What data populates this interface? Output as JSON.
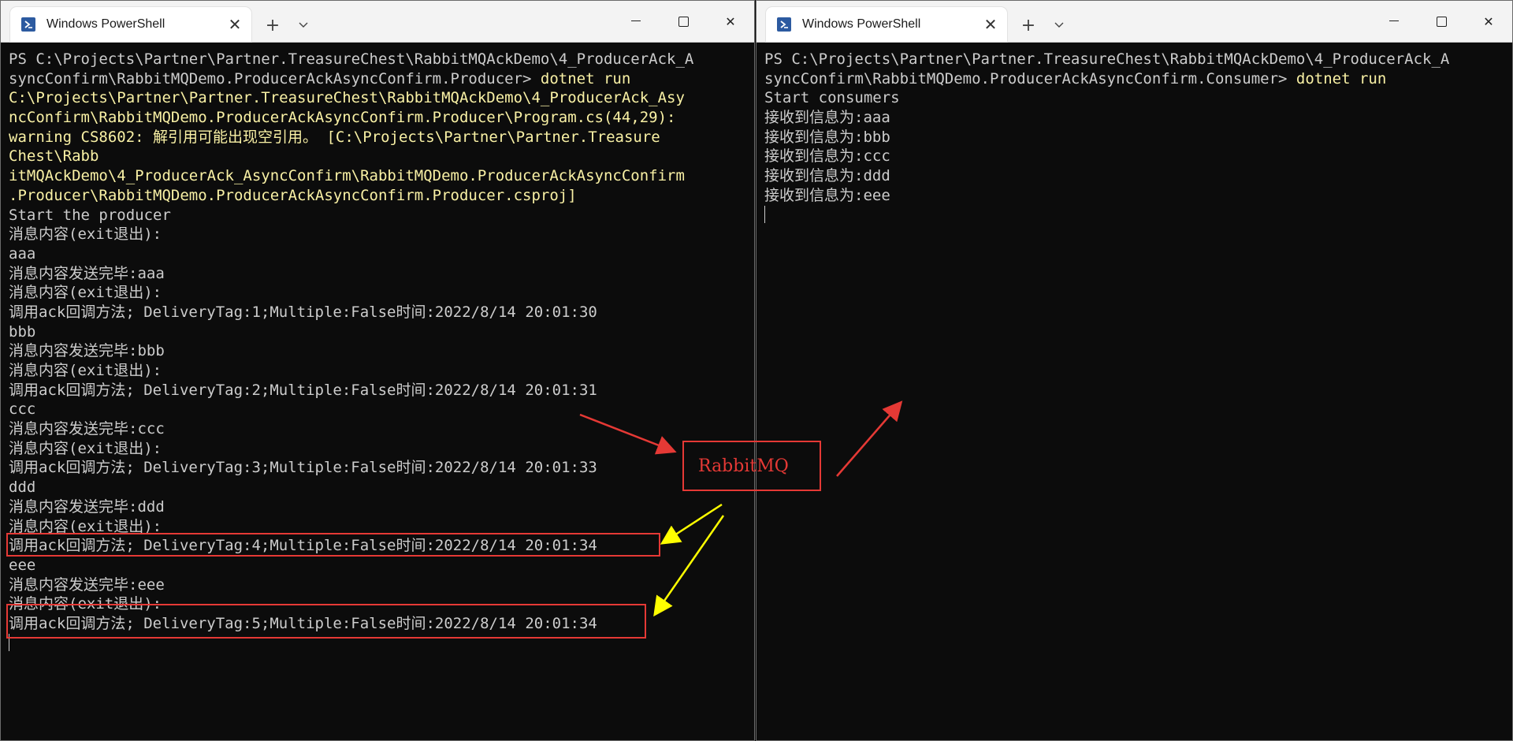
{
  "left_window": {
    "tab_title": "Windows PowerShell",
    "new_tab_label": "+",
    "dropdown_label": "⌄",
    "lines": [
      {
        "parts": [
          {
            "t": "PS C:\\Projects\\Partner\\Partner.TreasureChest\\RabbitMQAckDemo\\4_ProducerAck_A",
            "c": ""
          }
        ]
      },
      {
        "parts": [
          {
            "t": "syncConfirm\\RabbitMQDemo.ProducerAckAsyncConfirm.Producer> ",
            "c": ""
          },
          {
            "t": "dotnet run",
            "c": "cmd"
          }
        ]
      },
      {
        "warn": true,
        "parts": [
          {
            "t": "C:\\Projects\\Partner\\Partner.TreasureChest\\RabbitMQAckDemo\\4_ProducerAck_Asy",
            "c": ""
          }
        ]
      },
      {
        "warn": true,
        "parts": [
          {
            "t": "ncConfirm\\RabbitMQDemo.ProducerAckAsyncConfirm.Producer\\Program.cs(44,29):",
            "c": ""
          }
        ]
      },
      {
        "warn": true,
        "parts": [
          {
            "t": "warning CS8602: 解引用可能出现空引用。 [C:\\Projects\\Partner\\Partner.Treasure",
            "c": ""
          }
        ]
      },
      {
        "warn": true,
        "parts": [
          {
            "t": "Chest\\Rabb",
            "c": ""
          }
        ]
      },
      {
        "warn": true,
        "parts": [
          {
            "t": "itMQAckDemo\\4_ProducerAck_AsyncConfirm\\RabbitMQDemo.ProducerAckAsyncConfirm",
            "c": ""
          }
        ]
      },
      {
        "warn": true,
        "parts": [
          {
            "t": ".Producer\\RabbitMQDemo.ProducerAckAsyncConfirm.Producer.csproj]",
            "c": ""
          }
        ]
      },
      {
        "parts": [
          {
            "t": "Start the producer",
            "c": ""
          }
        ]
      },
      {
        "parts": [
          {
            "t": "消息内容(exit退出):",
            "c": ""
          }
        ]
      },
      {
        "parts": [
          {
            "t": "aaa",
            "c": ""
          }
        ]
      },
      {
        "parts": [
          {
            "t": "消息内容发送完毕:aaa",
            "c": ""
          }
        ]
      },
      {
        "parts": [
          {
            "t": "消息内容(exit退出):",
            "c": ""
          }
        ]
      },
      {
        "parts": [
          {
            "t": "调用ack回调方法; DeliveryTag:1;Multiple:False时间:2022/8/14 20:01:30",
            "c": ""
          }
        ]
      },
      {
        "parts": [
          {
            "t": "bbb",
            "c": ""
          }
        ]
      },
      {
        "parts": [
          {
            "t": "消息内容发送完毕:bbb",
            "c": ""
          }
        ]
      },
      {
        "parts": [
          {
            "t": "消息内容(exit退出):",
            "c": ""
          }
        ]
      },
      {
        "parts": [
          {
            "t": "调用ack回调方法; DeliveryTag:2;Multiple:False时间:2022/8/14 20:01:31",
            "c": ""
          }
        ]
      },
      {
        "parts": [
          {
            "t": "ccc",
            "c": ""
          }
        ]
      },
      {
        "parts": [
          {
            "t": "消息内容发送完毕:ccc",
            "c": ""
          }
        ]
      },
      {
        "parts": [
          {
            "t": "消息内容(exit退出):",
            "c": ""
          }
        ]
      },
      {
        "parts": [
          {
            "t": "调用ack回调方法; DeliveryTag:3;Multiple:False时间:2022/8/14 20:01:33",
            "c": ""
          }
        ]
      },
      {
        "parts": [
          {
            "t": "ddd",
            "c": ""
          }
        ]
      },
      {
        "parts": [
          {
            "t": "消息内容发送完毕:ddd",
            "c": ""
          }
        ]
      },
      {
        "parts": [
          {
            "t": "消息内容(exit退出):",
            "c": ""
          }
        ]
      },
      {
        "parts": [
          {
            "t": "调用ack回调方法; DeliveryTag:4;Multiple:False时间:2022/8/14 20:01:34",
            "c": ""
          }
        ]
      },
      {
        "parts": [
          {
            "t": "eee",
            "c": ""
          }
        ]
      },
      {
        "parts": [
          {
            "t": "消息内容发送完毕:eee",
            "c": ""
          }
        ]
      },
      {
        "parts": [
          {
            "t": "消息内容(exit退出):",
            "c": ""
          }
        ]
      },
      {
        "parts": [
          {
            "t": "调用ack回调方法; DeliveryTag:5;Multiple:False时间:2022/8/14 20:01:34",
            "c": ""
          }
        ]
      }
    ]
  },
  "right_window": {
    "tab_title": "Windows PowerShell",
    "new_tab_label": "+",
    "dropdown_label": "⌄",
    "lines": [
      {
        "parts": [
          {
            "t": "PS C:\\Projects\\Partner\\Partner.TreasureChest\\RabbitMQAckDemo\\4_ProducerAck_A",
            "c": ""
          }
        ]
      },
      {
        "parts": [
          {
            "t": "syncConfirm\\RabbitMQDemo.ProducerAckAsyncConfirm.Consumer> ",
            "c": ""
          },
          {
            "t": "dotnet run",
            "c": "cmd"
          }
        ]
      },
      {
        "parts": [
          {
            "t": "Start consumers",
            "c": ""
          }
        ]
      },
      {
        "parts": [
          {
            "t": "接收到信息为:aaa",
            "c": ""
          }
        ]
      },
      {
        "parts": [
          {
            "t": "接收到信息为:bbb",
            "c": ""
          }
        ]
      },
      {
        "parts": [
          {
            "t": "接收到信息为:ccc",
            "c": ""
          }
        ]
      },
      {
        "parts": [
          {
            "t": "接收到信息为:ddd",
            "c": ""
          }
        ]
      },
      {
        "parts": [
          {
            "t": "接收到信息为:eee",
            "c": ""
          }
        ]
      }
    ]
  },
  "annotation": {
    "label": "RabbitMQ",
    "box_color": "#e53935",
    "red_arrow_color": "#e53935",
    "yellow_arrow_color": "#ffff00"
  },
  "colors": {
    "terminal_bg": "#0c0c0c",
    "terminal_fg": "#cccccc",
    "command_yellow": "#f9f1a5",
    "titlebar_bg": "#f3f3f3"
  }
}
